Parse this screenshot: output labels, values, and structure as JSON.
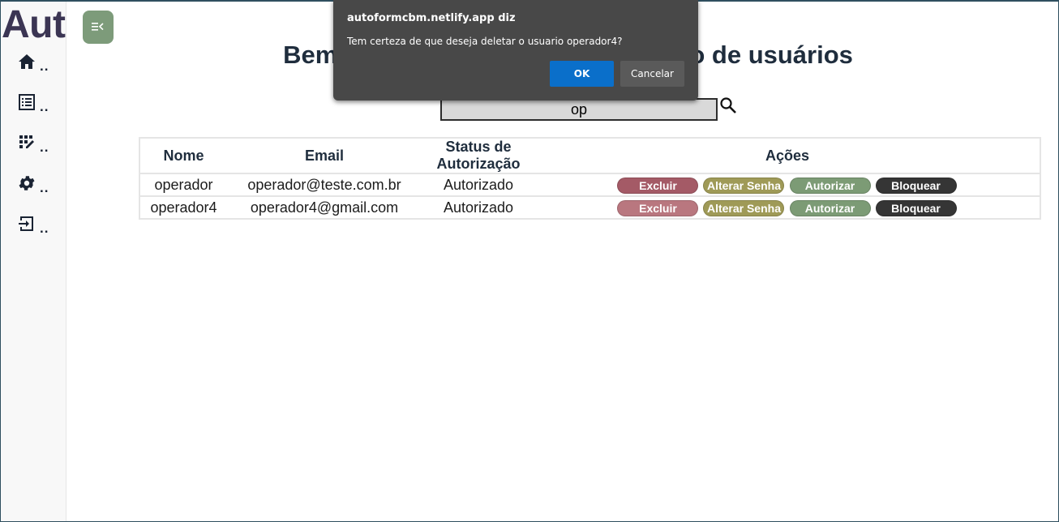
{
  "sidebar": {
    "brand": "Aut",
    "items": [
      {
        "icon": "home-icon",
        "label": ".."
      },
      {
        "icon": "list-icon",
        "label": ".."
      },
      {
        "icon": "edit-grid-icon",
        "label": ".."
      },
      {
        "icon": "gear-icon",
        "label": ".."
      },
      {
        "icon": "logout-icon",
        "label": ".."
      }
    ]
  },
  "toggle": {
    "icon": "collapse-menu-icon"
  },
  "main": {
    "title": "Bem-vindo à página de autorização de usuários",
    "search": {
      "value": "op",
      "icon": "search-icon"
    }
  },
  "table": {
    "headers": [
      "Nome",
      "Email",
      "Status de Autorização",
      "Ações"
    ],
    "rows": [
      {
        "nome": "operador",
        "email": "operador@teste.com.br",
        "status": "Autorizado"
      },
      {
        "nome": "operador4",
        "email": "operador4@gmail.com",
        "status": "Autorizado"
      }
    ],
    "actions": {
      "excluir": "Excluir",
      "alterar_senha": "Alterar Senha",
      "autorizar": "Autorizar",
      "bloquear": "Bloquear"
    }
  },
  "dialog": {
    "title": "autoformcbm.netlify.app diz",
    "message": "Tem certeza de que deseja deletar o usuario operador4?",
    "ok_label": "OK",
    "cancel_label": "Cancelar"
  },
  "colors": {
    "brand": "#3b3553",
    "toggle": "#7d9b7a",
    "excluir": "#a45a66",
    "alterar_senha": "#9f9a57",
    "autorizar": "#7c9b75",
    "bloquear": "#353535",
    "dialog_bg": "#484848",
    "ok_button": "#0a6fca"
  }
}
